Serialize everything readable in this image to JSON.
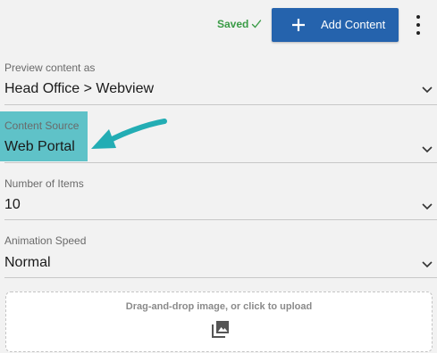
{
  "header": {
    "saved_text": "Saved",
    "add_button_label": "Add Content",
    "accent_color": "#2563ad",
    "saved_color": "#3a9b46"
  },
  "fields": [
    {
      "label": "Preview content as",
      "value": "Head Office > Webview"
    },
    {
      "label": "Content Source",
      "value": "Web Portal"
    },
    {
      "label": "Number of Items",
      "value": "10"
    },
    {
      "label": "Animation Speed",
      "value": "Normal"
    }
  ],
  "annotation": {
    "highlight_color": "#5fc2c8",
    "arrow_color": "#23adb4"
  },
  "upload": {
    "text": "Drag-and-drop image, or click to upload",
    "icon": "image-upload-icon"
  }
}
